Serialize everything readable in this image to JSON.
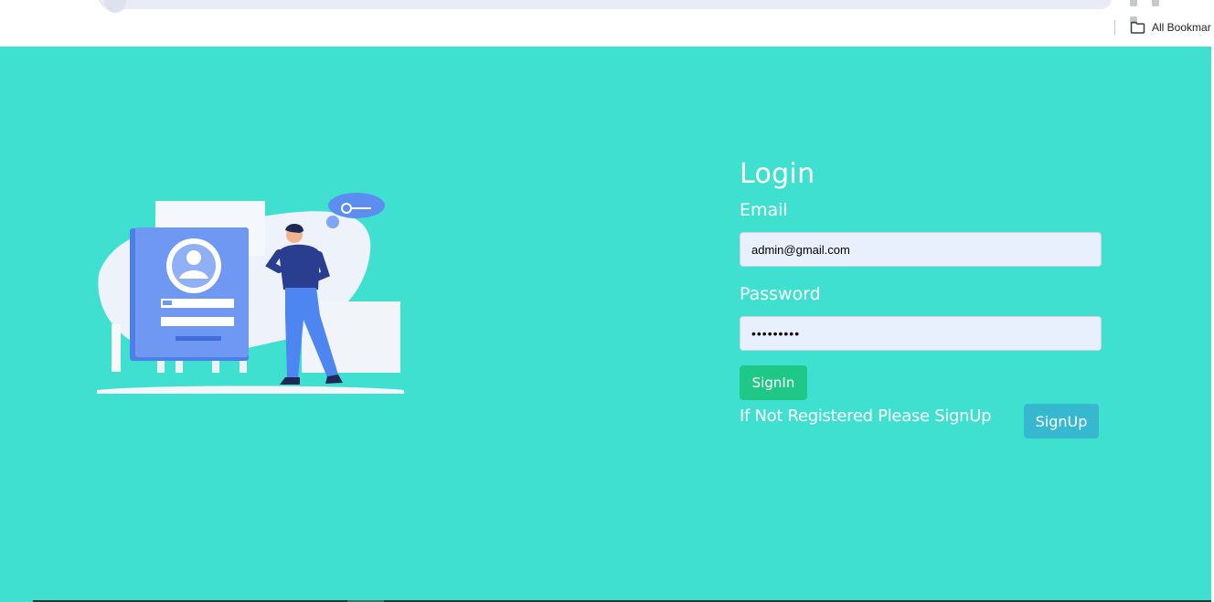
{
  "browser": {
    "bookmarks_label": "All Bookmar"
  },
  "login": {
    "title": "Login",
    "email_label": "Email",
    "email_value": "admin@gmail.com",
    "password_label": "Password",
    "password_value": "•••••••••",
    "signin_label": "SignIn",
    "register_prompt": "If Not Registered Please SignUp",
    "signup_label": "SignUp"
  },
  "theme": {
    "background": "#40e0d0",
    "signin_button": "#20c887",
    "signup_button": "#35b8d0",
    "input_background": "#e8f0fe"
  },
  "illustration": {
    "icon": "login-illustration"
  }
}
